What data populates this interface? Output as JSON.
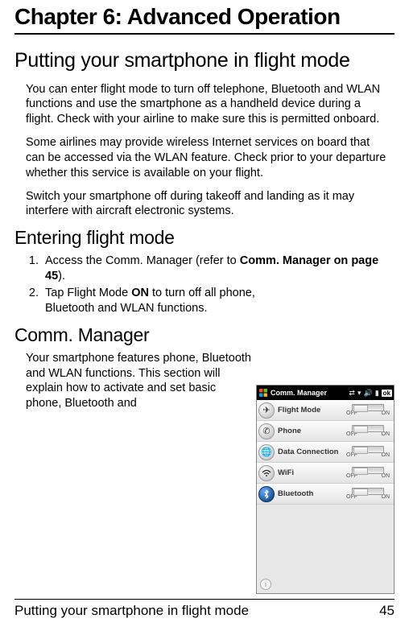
{
  "chapter_title": "Chapter 6: Advanced Operation",
  "section1": {
    "heading": "Putting your smartphone in flight mode",
    "p1": "You can enter flight mode to turn off telephone, Bluetooth and WLAN functions and use the smartphone as a handheld device during a flight. Check with your airline to make sure this is permitted onboard.",
    "p2": "Some airlines may provide wireless Internet services on board that can be accessed via the WLAN feature. Check prior to your departure whether this service is available on your flight.",
    "p3": "Switch your smartphone off during takeoff and landing as it may interfere with aircraft electronic systems."
  },
  "section2": {
    "heading": "Entering flight mode",
    "li1_a": "Access the Comm. Manager (refer to ",
    "li1_b": "Comm. Manager on page 45",
    "li1_c": ").",
    "li2_a": "Tap Flight Mode ",
    "li2_b": "ON",
    "li2_c": "  to turn off all phone, Bluetooth and WLAN functions."
  },
  "section3": {
    "heading": "Comm. Manager",
    "p1": "Your smartphone features phone, Bluetooth and WLAN functions. This section will explain how to activate and set basic phone, Bluetooth and"
  },
  "screenshot": {
    "title": "Comm. Manager",
    "ok": "ok",
    "off": "OFF",
    "on": "ON",
    "rows": {
      "flight": "Flight Mode",
      "phone": "Phone",
      "data": "Data Connection",
      "wifi": "WiFi",
      "bt": "Bluetooth"
    }
  },
  "footer": {
    "text": "Putting your smartphone in flight mode",
    "page": "45"
  }
}
